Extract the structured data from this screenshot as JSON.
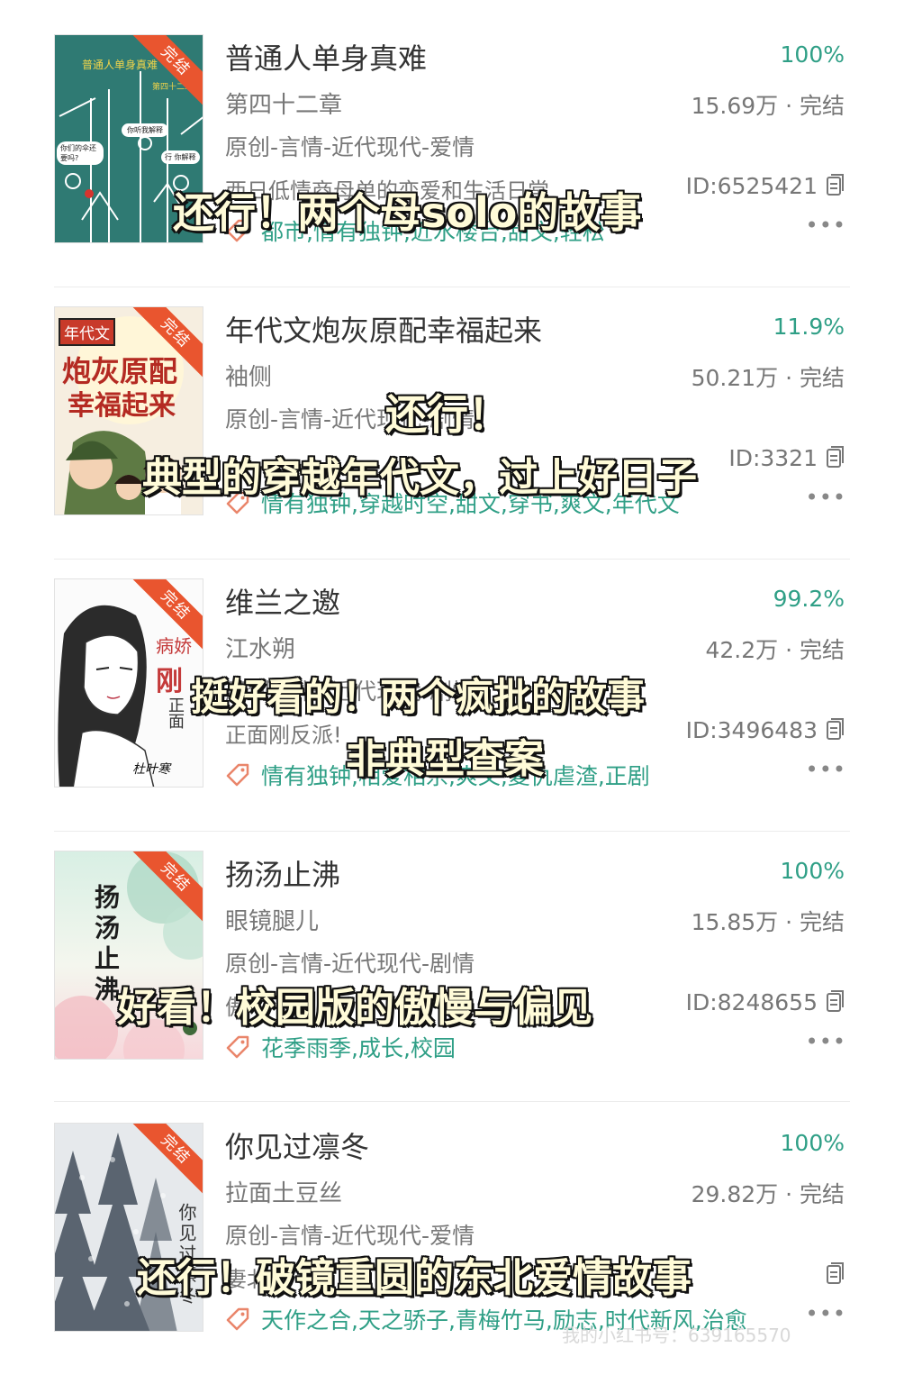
{
  "books": [
    {
      "title": "普通人单身真难",
      "percent": "100%",
      "author": "第四十二章",
      "stats": "15.69万 · 完结",
      "genre": "原创-言情-近代现代-爱情",
      "desc": "西日低情商母单的恋爱和生活日常",
      "id": "ID:6525421",
      "tags": "都市,情有独钟,近水楼台,甜文,轻松",
      "badge": "完结",
      "cover_title": "普通人单身真难",
      "cover_sub": "第四十二章",
      "cover_bubbles": [
        "你听我解释",
        "你们的伞还要吗?",
        "行 你解释"
      ],
      "overlay": "还行！两个母solo的故事"
    },
    {
      "title": "年代文炮灰原配幸福起来",
      "percent": "11.9%",
      "author": "袖侧",
      "stats": "50.21万 · 完结",
      "genre": "原创-言情-近代现代-剧情",
      "desc": "",
      "id": "ID:3321",
      "tags": "情有独钟,穿越时空,甜文,穿书,爽文,年代文",
      "badge": "完结",
      "cover_title": "炮灰原配",
      "cover_title2": "幸福起来",
      "cover_tag": "年代文",
      "overlay_lines": [
        "还行！",
        "典型的穿越年代文，过上好日子"
      ]
    },
    {
      "title": "维兰之邀",
      "percent": "99.2%",
      "author": "江水朔",
      "stats": "42.2万 · 完结",
      "genre": "原创-言情-近代现代-剧情",
      "desc": "正面刚反派!",
      "id": "ID:3496483",
      "tags": "情有独钟,相爱相杀,爽文,复仇虐渣,正剧",
      "badge": "完结",
      "cover_text": [
        "病娇",
        "刚",
        "正面"
      ],
      "cover_sign": "杜叶寒",
      "overlay_lines": [
        "挺好看的！两个疯批的故事",
        "非典型查案"
      ]
    },
    {
      "title": "扬汤止沸",
      "percent": "100%",
      "author": "眼镜腿儿",
      "stats": "15.85万 · 完结",
      "genre": "原创-言情-近代现代-剧情",
      "desc": "傲",
      "id": "ID:8248655",
      "tags": "花季雨季,成长,校园",
      "badge": "完结",
      "cover_title": "扬汤止沸",
      "overlay": "好看！校园版的傲慢与偏见"
    },
    {
      "title": "你见过凛冬",
      "percent": "100%",
      "author": "拉面土豆丝",
      "stats": "29.82万 · 完结",
      "genre": "原创-言情-近代现代-爱情",
      "desc": "妻北",
      "id": "",
      "tags": "天作之合,天之骄子,青梅竹马,励志,时代新风,治愈",
      "badge": "完结",
      "cover_title": "你见过凛冬",
      "overlay": "还行！破镜重圆的东北爱情故事"
    }
  ],
  "watermark": "我的小红书号：639165570",
  "colors": {
    "accent": "#2f9f86",
    "badge": "#e9552f",
    "overlay_text": "#fffbd8"
  }
}
